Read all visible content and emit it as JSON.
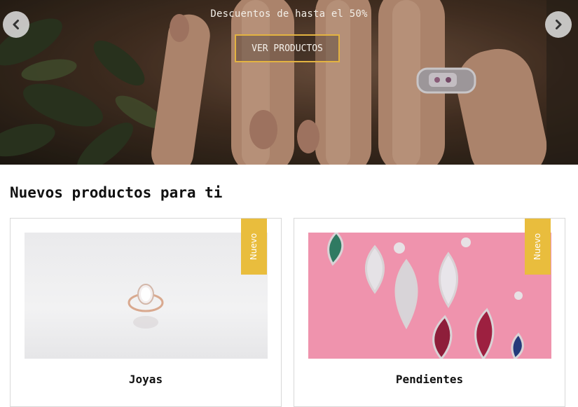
{
  "hero": {
    "subtitle": "Descuentos de hasta el 50%",
    "button_label": "VER PRODUCTOS",
    "prev_icon": "chevron-left-icon",
    "next_icon": "chevron-right-icon",
    "accent_color": "#e3b341"
  },
  "section": {
    "title": "Nuevos productos para ti"
  },
  "products": [
    {
      "name": "Joyas",
      "badge": "Nuevo"
    },
    {
      "name": "Pendientes",
      "badge": "Nuevo"
    }
  ],
  "colors": {
    "badge": "#e9bd3d",
    "card_border": "#d8d8d8",
    "earrings_background": "#ef93ad"
  }
}
